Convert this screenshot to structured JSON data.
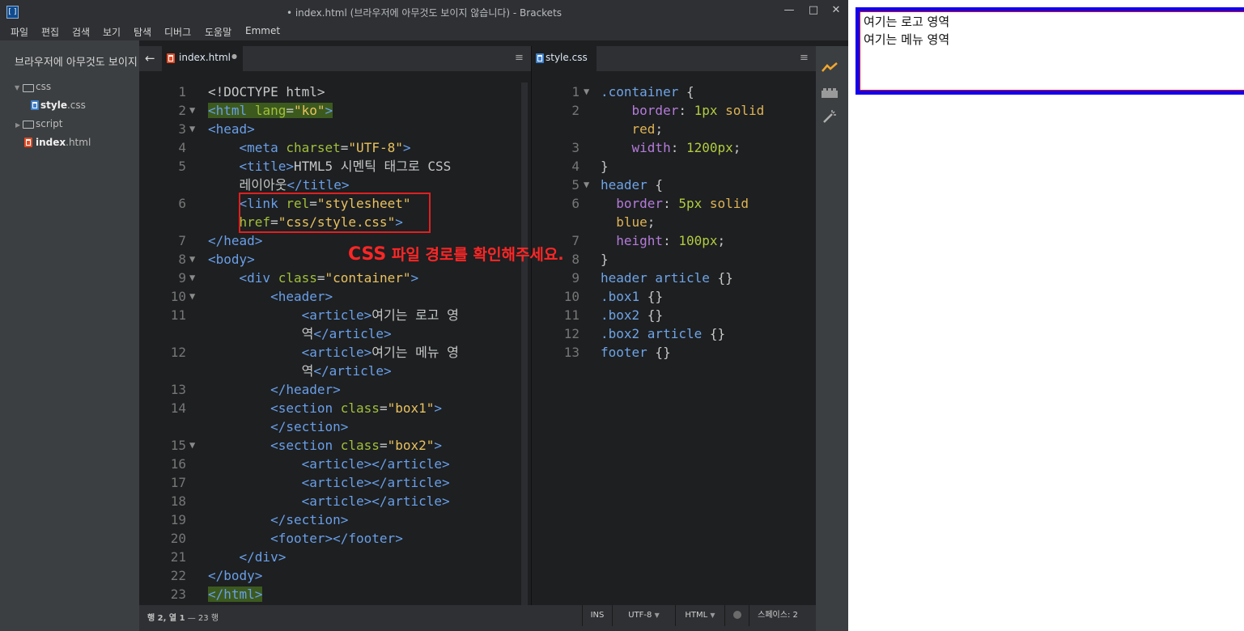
{
  "window": {
    "title": "• index.html (브라우저에 아무것도 보이지 않습니다) - Brackets",
    "controls": [
      "minimize",
      "maximize",
      "close"
    ]
  },
  "menubar": [
    "파일",
    "편집",
    "검색",
    "보기",
    "탐색",
    "디버그",
    "도움말",
    "Emmet"
  ],
  "sidebar": {
    "project_title": "브라우저에 아무것도 보이지",
    "tree": [
      {
        "label": "css",
        "kind": "folder",
        "expanded": true
      },
      {
        "label_bold": "style",
        "label_ext": ".css",
        "kind": "css-file"
      },
      {
        "label": "script",
        "kind": "folder",
        "expanded": false
      },
      {
        "label_bold": "index",
        "label_ext": ".html",
        "kind": "html-file"
      }
    ]
  },
  "left_pane": {
    "back_icon": "←",
    "tab_label": "index.html",
    "tab_dirty": "●",
    "pane_menu": "≡",
    "code": [
      {
        "n": "1",
        "fold": "",
        "html": "&lt;!DOCTYPE html&gt;"
      },
      {
        "n": "2",
        "fold": "▼",
        "html": "<span class=\"hl\"><span class=\"tag\">&lt;html</span> <span class=\"attr\">lang</span>=<span class=\"str\">\"ko\"</span><span class=\"tag\">&gt;</span></span>"
      },
      {
        "n": "3",
        "fold": "▼",
        "html": "<span class=\"tag\">&lt;head&gt;</span>"
      },
      {
        "n": "4",
        "fold": "",
        "html": "    <span class=\"tag\">&lt;meta</span> <span class=\"attr\">charset</span>=<span class=\"str\">\"UTF-8\"</span><span class=\"tag\">&gt;</span>"
      },
      {
        "n": "5",
        "fold": "",
        "html": "    <span class=\"tag\">&lt;title&gt;</span>HTML5 시멘틱 태그로 CSS"
      },
      {
        "n": "",
        "fold": "",
        "html": "    레이아웃<span class=\"tag\">&lt;/title&gt;</span>"
      },
      {
        "n": "6",
        "fold": "",
        "html": "    <span class=\"tag\">&lt;link</span> <span class=\"attr\">rel</span>=<span class=\"str\">\"stylesheet\"</span>"
      },
      {
        "n": "",
        "fold": "",
        "html": "    <span class=\"attr\">href</span>=<span class=\"str\">\"css/style.css\"</span><span class=\"tag\">&gt;</span>"
      },
      {
        "n": "7",
        "fold": "",
        "html": "<span class=\"tag\">&lt;/head&gt;</span>"
      },
      {
        "n": "8",
        "fold": "▼",
        "html": "<span class=\"tag\">&lt;body&gt;</span>"
      },
      {
        "n": "9",
        "fold": "▼",
        "html": "    <span class=\"tag\">&lt;div</span> <span class=\"attr\">class</span>=<span class=\"str\">\"container\"</span><span class=\"tag\">&gt;</span>"
      },
      {
        "n": "10",
        "fold": "▼",
        "html": "        <span class=\"tag\">&lt;header&gt;</span>"
      },
      {
        "n": "11",
        "fold": "",
        "html": "            <span class=\"tag\">&lt;article&gt;</span>여기는 로고 영"
      },
      {
        "n": "",
        "fold": "",
        "html": "            역<span class=\"tag\">&lt;/article&gt;</span>"
      },
      {
        "n": "12",
        "fold": "",
        "html": "            <span class=\"tag\">&lt;article&gt;</span>여기는 메뉴 영"
      },
      {
        "n": "",
        "fold": "",
        "html": "            역<span class=\"tag\">&lt;/article&gt;</span>"
      },
      {
        "n": "13",
        "fold": "",
        "html": "        <span class=\"tag\">&lt;/header&gt;</span>"
      },
      {
        "n": "14",
        "fold": "",
        "html": "        <span class=\"tag\">&lt;section</span> <span class=\"attr\">class</span>=<span class=\"str\">\"box1\"</span><span class=\"tag\">&gt;</span>"
      },
      {
        "n": "",
        "fold": "",
        "html": "        <span class=\"tag\">&lt;/section&gt;</span>"
      },
      {
        "n": "15",
        "fold": "▼",
        "html": "        <span class=\"tag\">&lt;section</span> <span class=\"attr\">class</span>=<span class=\"str\">\"box2\"</span><span class=\"tag\">&gt;</span>"
      },
      {
        "n": "16",
        "fold": "",
        "html": "            <span class=\"tag\">&lt;article&gt;&lt;/article&gt;</span>"
      },
      {
        "n": "17",
        "fold": "",
        "html": "            <span class=\"tag\">&lt;article&gt;&lt;/article&gt;</span>"
      },
      {
        "n": "18",
        "fold": "",
        "html": "            <span class=\"tag\">&lt;article&gt;&lt;/article&gt;</span>"
      },
      {
        "n": "19",
        "fold": "",
        "html": "        <span class=\"tag\">&lt;/section&gt;</span>"
      },
      {
        "n": "20",
        "fold": "",
        "html": "        <span class=\"tag\">&lt;footer&gt;&lt;/footer&gt;</span>"
      },
      {
        "n": "21",
        "fold": "",
        "html": "    <span class=\"tag\">&lt;/div&gt;</span>"
      },
      {
        "n": "22",
        "fold": "",
        "html": "<span class=\"tag\">&lt;/body&gt;</span>"
      },
      {
        "n": "23",
        "fold": "",
        "html": "<span class=\"hl\"><span class=\"tag\">&lt;/html&gt;</span></span>"
      }
    ]
  },
  "right_pane": {
    "tab_label": "style.css",
    "pane_menu": "≡",
    "code": [
      {
        "n": "1",
        "fold": "▼",
        "html": "<span class=\"sel\">.container</span> {"
      },
      {
        "n": "2",
        "fold": "",
        "html": "    <span class=\"prop\">border</span>: <span class=\"num\">1px</span> <span class=\"val\">solid</span>"
      },
      {
        "n": "",
        "fold": "",
        "html": "    <span class=\"val\">red</span>;"
      },
      {
        "n": "3",
        "fold": "",
        "html": "    <span class=\"prop\">width</span>: <span class=\"num\">1200px</span>;"
      },
      {
        "n": "4",
        "fold": "",
        "html": "}"
      },
      {
        "n": "5",
        "fold": "▼",
        "html": "<span class=\"sel\">header</span> {"
      },
      {
        "n": "6",
        "fold": "",
        "html": "  <span class=\"prop\">border</span>: <span class=\"num\">5px</span> <span class=\"val\">solid</span>"
      },
      {
        "n": "",
        "fold": "",
        "html": "  <span class=\"val\">blue</span>;"
      },
      {
        "n": "7",
        "fold": "",
        "html": "  <span class=\"prop\">height</span>: <span class=\"num\">100px</span>;"
      },
      {
        "n": "8",
        "fold": "",
        "html": "}"
      },
      {
        "n": "9",
        "fold": "",
        "html": "<span class=\"sel\">header article</span> {}"
      },
      {
        "n": "10",
        "fold": "",
        "html": "<span class=\"sel\">.box1</span> {}"
      },
      {
        "n": "11",
        "fold": "",
        "html": "<span class=\"sel\">.box2</span> {}"
      },
      {
        "n": "12",
        "fold": "",
        "html": "<span class=\"sel\">.box2 article</span> {}"
      },
      {
        "n": "13",
        "fold": "",
        "html": "<span class=\"sel\">footer</span> {}"
      }
    ]
  },
  "statusbar": {
    "position_bold": "행 2, 열 1",
    "position_rest": " — 23 행",
    "ins": "INS",
    "encoding": "UTF-8",
    "language": "HTML",
    "indent": "스페이스: 2"
  },
  "annotation": {
    "text_bold": "CSS",
    "text_rest": " 파일 경로를 확인해주세요.",
    "color": "#ff2626"
  },
  "preview": {
    "line1": "여기는 로고 영역",
    "line2": "여기는 메뉴 영역"
  },
  "colors": {
    "editor_bg": "#1d1f21",
    "tag": "#6a9fe8",
    "attr": "#a2bf3a",
    "string": "#eac25e",
    "header_border": "#1100ee",
    "container_border": "#ee0000"
  }
}
